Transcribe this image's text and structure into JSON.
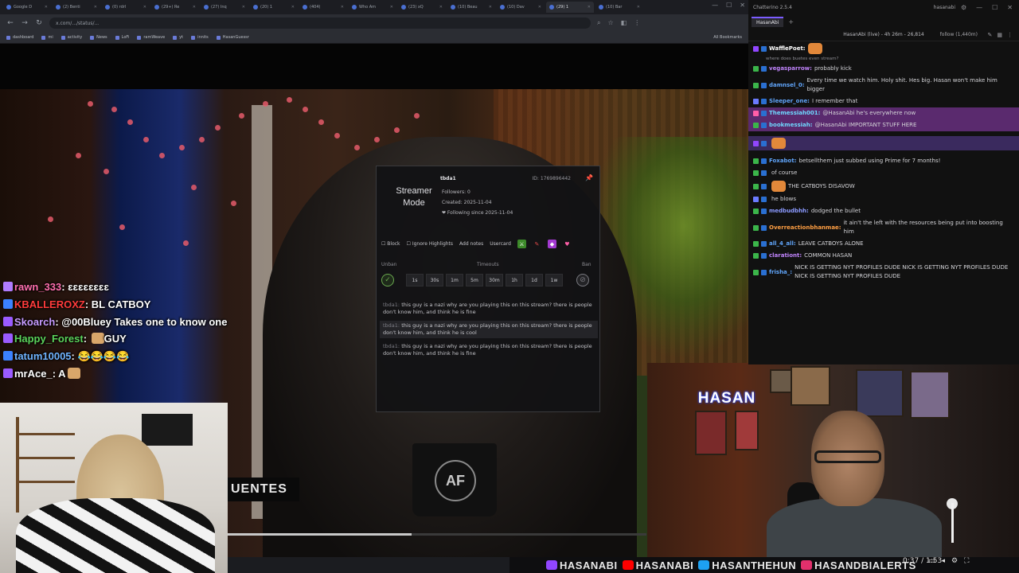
{
  "browser": {
    "tabs": [
      {
        "label": "Google D"
      },
      {
        "label": "(2) Benti"
      },
      {
        "label": "(0) rdrl"
      },
      {
        "label": "(29+) Re"
      },
      {
        "label": "(27) Inq"
      },
      {
        "label": "(20) 1"
      },
      {
        "label": "(404)"
      },
      {
        "label": "Who Am"
      },
      {
        "label": "(23) xQ"
      },
      {
        "label": "(10) Beau"
      },
      {
        "label": "(10) Dav"
      },
      {
        "label": "(29) 1"
      },
      {
        "label": "(10) Bar"
      }
    ],
    "url": "x.com/.../status/...",
    "bookmarks": [
      "dashboard",
      "mi",
      "activity",
      "News",
      "LoFi",
      "ramWeave",
      "yt",
      "innits",
      "HasanGuessr"
    ],
    "all_bookmarks": "All Bookmarks"
  },
  "streamer_popup": {
    "mode_label": "Streamer Mode",
    "username": "tbda1",
    "user_id": "ID: 1769896442",
    "followers": "Followers: 0",
    "created": "Created: 2025-11-04",
    "following_since": "❤ Following since 2025-11-04",
    "actions": [
      "Block",
      "Ignore Highlights",
      "Add notes",
      "Usercard"
    ],
    "unban_label": "Unban",
    "timeouts_label": "Timeouts",
    "ban_label": "Ban",
    "timeouts": [
      "1s",
      "30s",
      "1m",
      "5m",
      "30m",
      "1h",
      "1d",
      "1w"
    ],
    "messages": [
      {
        "who": "tbda1:",
        "text": "this guy is a nazi why are you playing this on this stream? there is people don't know him, and think he is fine"
      },
      {
        "who": "tbda1:",
        "text": "this guy is a nazi why are you playing this on this stream? there is people don't know him, and think he is cool"
      },
      {
        "who": "tbda1:",
        "text": "this guy is a nazi why are you playing this on this stream? there is people don't know him, and think he is fine"
      }
    ]
  },
  "video": {
    "lower_third": "UENTES",
    "mug_logo": "AF",
    "progress": 0.44
  },
  "overlay_chat": [
    {
      "user": "rawn_333",
      "text": "ɛɛɛɛɛɛɛɛ",
      "color": "#ff6fae",
      "badge": "#b07cff"
    },
    {
      "user": "KBALLEROXZ",
      "text": "BL CATBOY",
      "color": "#ff3b3b",
      "badge": "#3b82ff"
    },
    {
      "user": "Skoarch",
      "text": "@00Bluey Takes one to know one",
      "color": "#c79bff",
      "badge": "#9a5bff"
    },
    {
      "user": "Happy_Forest",
      "text": "GUY",
      "color": "#5bd35b",
      "badge": "#9a5bff"
    },
    {
      "user": "tatum10005",
      "text": "😂😂😂😂",
      "color": "#6fb4ff",
      "badge": "#3b82ff"
    },
    {
      "user": "mrAce_",
      "text": "A",
      "color": "#ffffff",
      "badge": "#9a5bff"
    }
  ],
  "webcam_right": {
    "logo": "HASAN"
  },
  "social_bar": [
    {
      "label": "HASANABI",
      "color": "#9146ff"
    },
    {
      "label": "HASANABI",
      "color": "#ff0000"
    },
    {
      "label": "HASANTHEHUN",
      "color": "#1da1f2"
    },
    {
      "label": "HASANDBIALERTS",
      "color": "#e1306c"
    }
  ],
  "player": {
    "time": "0:37 / 1:53"
  },
  "chatterino": {
    "app_title": "Chatterino 2.5.4",
    "account": "hasanabi",
    "tab_label": "HasanAbi",
    "header": "HasanAbi (live) - 4h 26m - 26,814",
    "followers": "follow (1,440m)",
    "messages": [
      {
        "user": "WafflePoet:",
        "text": "",
        "color": "#ffffff",
        "badge": "#9146ff",
        "emote": true,
        "style": ""
      },
      {
        "reply": "where does buetes even stream?"
      },
      {
        "user": "vegasparrow:",
        "text": "probably kick",
        "color": "#c084fc",
        "badge": "#3bb54a",
        "style": ""
      },
      {
        "user": "damnsel_0:",
        "text": "Every time we watch him. Holy shit. Hes big. Hasan won't make him bigger",
        "color": "#60a5fa",
        "badge": "#3bb54a",
        "style": ""
      },
      {
        "user": "Sleeper_one:",
        "text": "I remember that",
        "color": "#60a5fa",
        "badge": "#6b7bff",
        "style": ""
      },
      {
        "user": "Themessiah001:",
        "text": "@HasanAbi he's everywhere now",
        "color": "#6fd8ff",
        "badge": "#ff5fa8",
        "style": "hl-pink"
      },
      {
        "user": "bookmessiah:",
        "text": "@HasanAbi IMPORTANT STUFF HERE",
        "color": "#6fd8ff",
        "badge": "#3bb54a",
        "style": "hl-pink"
      },
      {
        "user": "",
        "text": "",
        "color": "#ffffff",
        "badge": "#9146ff",
        "emote": true,
        "style": "hl-purple"
      },
      {
        "user": "Foxabot:",
        "text": "betsellthem just subbed using Prime for 7 months!",
        "color": "#60a5fa",
        "badge": "#3bb54a",
        "style": ""
      },
      {
        "user": "",
        "text": "of course",
        "color": "#c084fc",
        "badge": "#3bb54a",
        "style": ""
      },
      {
        "user": "",
        "text": "THE CATBOYS DISAVOW",
        "color": "#ff9f43",
        "badge": "#3bb54a",
        "emote": true,
        "style": ""
      },
      {
        "user": "",
        "text": "he blows",
        "color": "#c084fc",
        "badge": "#6b7bff",
        "style": ""
      },
      {
        "user": "medbudbhh:",
        "text": "dodged the bullet",
        "color": "#8b9aff",
        "badge": "#3bb54a",
        "style": ""
      },
      {
        "user": "Overreactionbhanmae:",
        "text": "it ain't the left with the resources being put into boosting him",
        "color": "#ff9f43",
        "badge": "#3bb54a",
        "style": ""
      },
      {
        "user": "all_4_all:",
        "text": "LEAVE CATBOYS ALONE",
        "color": "#60a5fa",
        "badge": "#3bb54a",
        "style": ""
      },
      {
        "user": "clarationt:",
        "text": "COMMON HASAN",
        "color": "#c084fc",
        "badge": "#3bb54a",
        "style": ""
      },
      {
        "user": "frisha_:",
        "text": "NICK IS GETTING NYT PROFILES DUDE NICK IS GETTING NYT PROFILES DUDE NICK IS GETTING NYT PROFILES DUDE",
        "color": "#60a5fa",
        "badge": "#3bb54a",
        "style": ""
      }
    ]
  }
}
